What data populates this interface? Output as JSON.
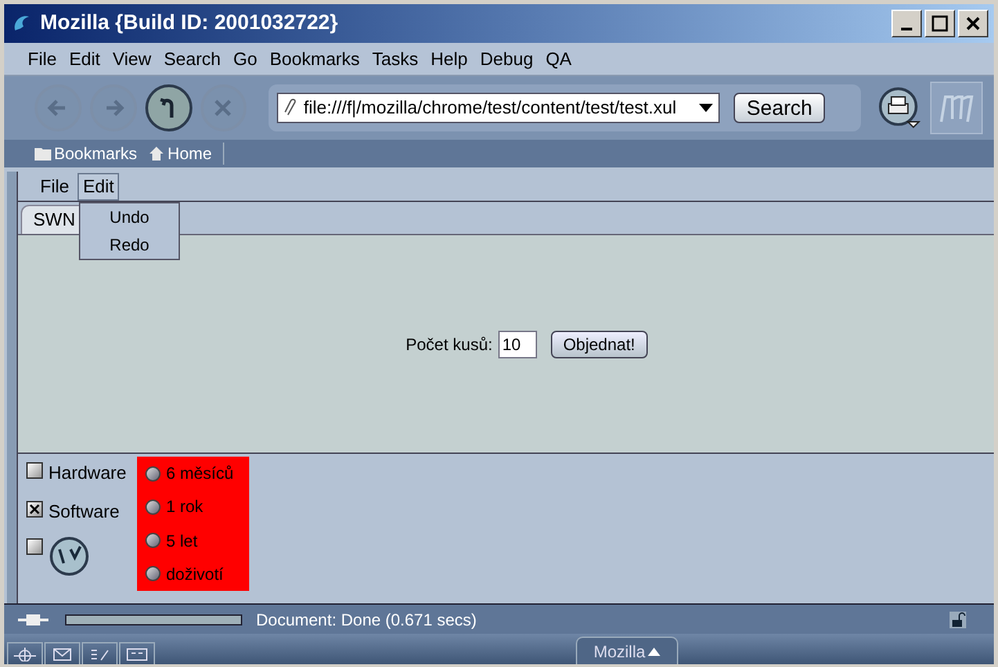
{
  "window": {
    "title": "Mozilla {Build ID: 2001032722}"
  },
  "menubar": [
    "File",
    "Edit",
    "View",
    "Search",
    "Go",
    "Bookmarks",
    "Tasks",
    "Help",
    "Debug",
    "QA"
  ],
  "toolbar": {
    "url": "file:///f|/mozilla/chrome/test/content/test/test.xul",
    "search_button": "Search"
  },
  "personal_bar": [
    "Bookmarks",
    "Home"
  ],
  "page": {
    "menubar": [
      {
        "label": "File",
        "selected": false
      },
      {
        "label": "Edit",
        "selected": true
      }
    ],
    "menu": [
      "Undo",
      "Redo"
    ],
    "tabs": [
      {
        "label": "SWN",
        "selected": true
      }
    ],
    "form": {
      "label": "Počet kusů:",
      "value": "10",
      "button": "Objednat!"
    },
    "checkboxes": [
      {
        "kind": "text",
        "label": "Hardware",
        "checked": false
      },
      {
        "kind": "text",
        "label": "Software",
        "checked": true
      },
      {
        "kind": "icon",
        "checked": false
      }
    ],
    "radios": [
      {
        "label": "6 měsíců",
        "selected": false
      },
      {
        "label": "1 rok",
        "selected": false
      },
      {
        "label": "5 let",
        "selected": false
      },
      {
        "label": "doživotí",
        "selected": false
      }
    ]
  },
  "status_bar": {
    "progress": {
      "level": 0
    },
    "text": "Document: Done (0.671 secs)"
  },
  "taskbar": {
    "button": "Mozilla"
  }
}
